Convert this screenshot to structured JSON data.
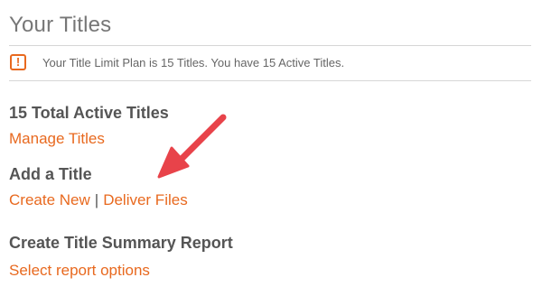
{
  "page": {
    "title": "Your Titles"
  },
  "notice": {
    "icon": "alert-square-icon",
    "icon_glyph": "!",
    "text": "Your Title Limit Plan is 15 Titles. You have 15 Active Titles."
  },
  "sections": {
    "active_titles": {
      "heading": "15 Total Active Titles",
      "link": "Manage Titles"
    },
    "add_title": {
      "heading": "Add a Title",
      "create_link": "Create New",
      "separator": "|",
      "deliver_link": "Deliver Files"
    },
    "summary_report": {
      "heading": "Create Title Summary Report",
      "link": "Select report options"
    }
  },
  "colors": {
    "accent": "#e8691f",
    "heading": "#555555",
    "annotation_arrow": "#e8434a"
  }
}
